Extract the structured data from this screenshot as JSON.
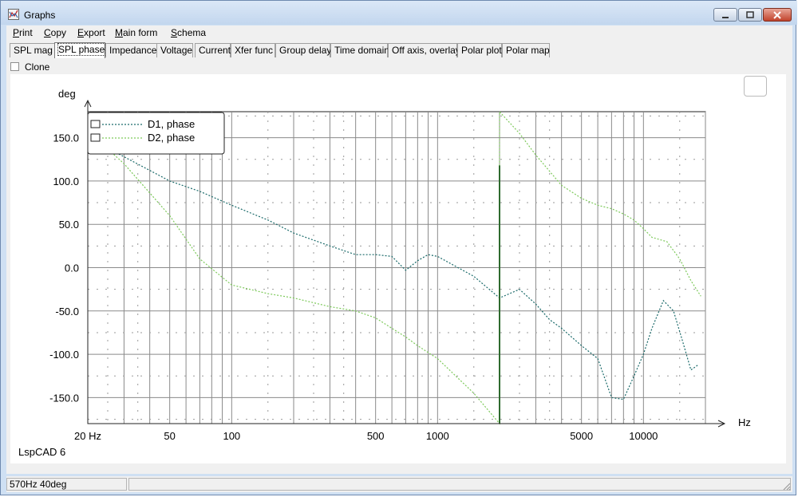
{
  "window": {
    "title": "Graphs",
    "app_icon": "lspcad-icon"
  },
  "title_buttons": [
    "minimize-icon",
    "maximize-icon",
    "close-icon"
  ],
  "menu": [
    {
      "label": "Print",
      "access_key": "P",
      "rest": "rint"
    },
    {
      "label": "Copy",
      "access_key": "C",
      "rest": "opy"
    },
    {
      "label": "Export",
      "access_key": "E",
      "rest": "xport"
    },
    {
      "label": "Main form",
      "access_key": "M",
      "rest": "ain form"
    },
    {
      "label": "Schema",
      "access_key": "S",
      "rest": "chema"
    }
  ],
  "tabs": [
    {
      "label": "SPL mag"
    },
    {
      "label": "SPL phase",
      "active": true
    },
    {
      "label": "Impedance"
    },
    {
      "label": "Voltage"
    },
    {
      "label": "Current"
    },
    {
      "label": "Xfer func"
    },
    {
      "label": "Group delay"
    },
    {
      "label": "Time domain"
    },
    {
      "label": "Off axis, overlay"
    },
    {
      "label": "Polar plot"
    },
    {
      "label": "Polar map"
    }
  ],
  "clone": {
    "label": "Clone",
    "checked": false
  },
  "watermark": "LspCAD 6",
  "status": {
    "cursor_readout": "570Hz 40deg",
    "right": ""
  },
  "chart_data": {
    "type": "line",
    "xscale": "log",
    "xlim": [
      20,
      20000
    ],
    "ylim": [
      -180,
      180
    ],
    "xlabel": "Hz",
    "ylabel": "deg",
    "x_tick_labels": [
      "20 Hz",
      "50",
      "100",
      "500",
      "1000",
      "5000",
      "10000"
    ],
    "x_tick_values": [
      20,
      50,
      100,
      500,
      1000,
      5000,
      10000
    ],
    "y_tick_labels": [
      "150.0",
      "100.0",
      "50.0",
      "0.0",
      "-50.0",
      "-100.0",
      "-150.0"
    ],
    "y_tick_values": [
      150,
      100,
      50,
      0,
      -50,
      -100,
      -150
    ],
    "grid": true,
    "legend": "top-left",
    "series": [
      {
        "name": "D1, phase",
        "color": "#1a6a6a",
        "points": [
          [
            20,
            150
          ],
          [
            30,
            128
          ],
          [
            50,
            100
          ],
          [
            70,
            88
          ],
          [
            100,
            72
          ],
          [
            150,
            55
          ],
          [
            200,
            40
          ],
          [
            300,
            25
          ],
          [
            400,
            15
          ],
          [
            500,
            15
          ],
          [
            600,
            13
          ],
          [
            700,
            -3
          ],
          [
            800,
            8
          ],
          [
            900,
            15
          ],
          [
            1000,
            13
          ],
          [
            1500,
            -10
          ],
          [
            2000,
            -35
          ],
          [
            2500,
            -25
          ],
          [
            3000,
            -42
          ],
          [
            3500,
            -60
          ],
          [
            4000,
            -70
          ],
          [
            5000,
            -90
          ],
          [
            6000,
            -105
          ],
          [
            7000,
            -150
          ],
          [
            8000,
            -152
          ],
          [
            9000,
            -125
          ],
          [
            10000,
            -100
          ],
          [
            11000,
            -70
          ],
          [
            12500,
            -38
          ],
          [
            14000,
            -50
          ],
          [
            15500,
            -85
          ],
          [
            17000,
            -118
          ],
          [
            18500,
            -112
          ]
        ]
      },
      {
        "name": "D2, phase",
        "color": "#7dc95a",
        "points": [
          [
            20,
            158
          ],
          [
            30,
            120
          ],
          [
            50,
            60
          ],
          [
            70,
            10
          ],
          [
            100,
            -20
          ],
          [
            150,
            -30
          ],
          [
            200,
            -35
          ],
          [
            300,
            -45
          ],
          [
            400,
            -50
          ],
          [
            500,
            -58
          ],
          [
            600,
            -70
          ],
          [
            700,
            -80
          ],
          [
            800,
            -90
          ],
          [
            1000,
            -105
          ],
          [
            1500,
            -145
          ],
          [
            2000,
            -180
          ],
          [
            2000,
            180
          ],
          [
            2500,
            155
          ],
          [
            3000,
            130
          ],
          [
            4000,
            95
          ],
          [
            5000,
            80
          ],
          [
            6000,
            72
          ],
          [
            7000,
            68
          ],
          [
            8000,
            62
          ],
          [
            9000,
            55
          ],
          [
            10000,
            45
          ],
          [
            11000,
            35
          ],
          [
            13000,
            30
          ],
          [
            15000,
            10
          ],
          [
            17000,
            -15
          ],
          [
            19000,
            -33
          ]
        ]
      }
    ],
    "annotations": [
      {
        "type": "spike",
        "x": 2000,
        "y_from": -180,
        "y_to": 118
      }
    ]
  }
}
